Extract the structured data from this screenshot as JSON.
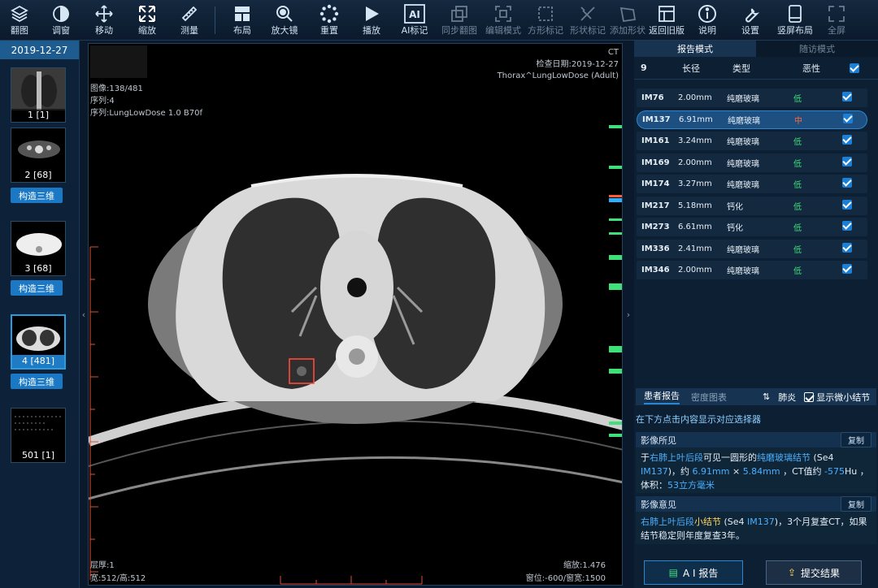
{
  "toolbar": {
    "items": [
      {
        "label": "翻图",
        "icon": "stack-layers-icon"
      },
      {
        "label": "调窗",
        "icon": "contrast-circle-icon"
      },
      {
        "label": "移动",
        "icon": "move-arrows-icon"
      },
      {
        "label": "缩放",
        "icon": "zoom-expand-icon"
      },
      {
        "label": "测量",
        "icon": "ruler-icon"
      },
      {
        "label": "布局",
        "icon": "layout-grid-icon"
      },
      {
        "label": "放大镜",
        "icon": "magnifier-icon"
      },
      {
        "label": "重置",
        "icon": "reset-dots-icon"
      },
      {
        "label": "播放",
        "icon": "play-icon"
      },
      {
        "label": "AI标记",
        "icon": "ai-box-icon"
      },
      {
        "label": "同步翻图",
        "icon": "sync-pages-icon"
      },
      {
        "label": "编辑模式",
        "icon": "edit-frame-icon"
      },
      {
        "label": "方形标记",
        "icon": "square-mark-icon"
      },
      {
        "label": "形状标记",
        "icon": "shape-mark-icon"
      },
      {
        "label": "添加形状",
        "icon": "add-shape-icon"
      },
      {
        "label": "返回旧版",
        "icon": "old-version-icon"
      },
      {
        "label": "说明",
        "icon": "info-icon"
      },
      {
        "label": "设置",
        "icon": "wrench-icon"
      },
      {
        "label": "竖屏布局",
        "icon": "portrait-layout-icon"
      },
      {
        "label": "全屏",
        "icon": "fullscreen-icon"
      }
    ]
  },
  "left": {
    "date": "2019-12-27",
    "series": [
      {
        "caption": "1 [1]",
        "build3d": ""
      },
      {
        "caption": "2 [68]",
        "build3d": "构造三维"
      },
      {
        "caption": "3 [68]",
        "build3d": "构造三维"
      },
      {
        "caption": "4 [481]",
        "build3d": "构造三维"
      },
      {
        "caption": "501 [1]",
        "build3d": ""
      }
    ]
  },
  "viewer": {
    "modality": "CT",
    "exam_date": "检查日期:2019-12-27",
    "protocol": "Thorax^LungLowDose (Adult)",
    "image": "图像:138/481",
    "series": "序列:4",
    "series_desc": "序列:LungLowDose 1.0 B70f",
    "thickness": "层厚:1",
    "size": "宽:512/高:512",
    "zoom": "缩放:1.476",
    "window": "窗位:-600/窗宽:1500"
  },
  "right": {
    "tabs": [
      "报告模式",
      "随访模式"
    ],
    "table": {
      "count": "9",
      "headers": [
        "长径",
        "类型",
        "恶性"
      ],
      "rows": [
        {
          "id": "IM76",
          "len": "2.00mm",
          "type": "纯磨玻璃",
          "risk": "低",
          "risk_color": "#3fe07a"
        },
        {
          "id": "IM137",
          "len": "6.91mm",
          "type": "纯磨玻璃",
          "risk": "中",
          "risk_color": "#ff6a3a"
        },
        {
          "id": "IM161",
          "len": "3.24mm",
          "type": "纯磨玻璃",
          "risk": "低",
          "risk_color": "#3fe07a"
        },
        {
          "id": "IM169",
          "len": "2.00mm",
          "type": "纯磨玻璃",
          "risk": "低",
          "risk_color": "#3fe07a"
        },
        {
          "id": "IM174",
          "len": "3.27mm",
          "type": "纯磨玻璃",
          "risk": "低",
          "risk_color": "#3fe07a"
        },
        {
          "id": "IM217",
          "len": "5.18mm",
          "type": "钙化",
          "risk": "低",
          "risk_color": "#3fe07a"
        },
        {
          "id": "IM273",
          "len": "6.61mm",
          "type": "钙化",
          "risk": "低",
          "risk_color": "#3fe07a"
        },
        {
          "id": "IM336",
          "len": "2.41mm",
          "type": "纯磨玻璃",
          "risk": "低",
          "risk_color": "#3fe07a"
        },
        {
          "id": "IM346",
          "len": "2.00mm",
          "type": "纯磨玻璃",
          "risk": "低",
          "risk_color": "#3fe07a"
        }
      ]
    },
    "report_tabs": [
      "患者报告",
      "密度图表"
    ],
    "pneumonia": "肺炎",
    "show_micro": "显示微小结节",
    "hint": "在下方点击内容显示对应选择器",
    "findings_title": "影像所见",
    "copy": "复制",
    "findings": {
      "p1": "于",
      "loc": "右肺上叶后段",
      "p2": "可见一圆形的",
      "kind": "纯磨玻璃结节",
      "p3": " (Se4 ",
      "im": "IM137",
      "p4": ")，约 ",
      "d1": "6.91mm",
      "p5": " × ",
      "d2": "5.84mm",
      "p6": " ，CT值约 ",
      "hu": "-575",
      "p7": "Hu ，体积：",
      "vol": "53立方毫米"
    },
    "opinion_title": "影像意见",
    "opinion": {
      "loc": "右肺上叶后段",
      "kind": "小结节",
      "p1": " (Se4 ",
      "im": "IM137",
      "p2": ")，3个月复查CT，如果结节稳定则年度复查3年。"
    },
    "ai_report": "A I 报告",
    "submit": "提交结果"
  },
  "colors": {
    "accent": "#2b86d1",
    "low": "#3fe07a",
    "mid": "#ff6a3a",
    "blue_text": "#49b0ff",
    "yellow_text": "#ffd860"
  }
}
